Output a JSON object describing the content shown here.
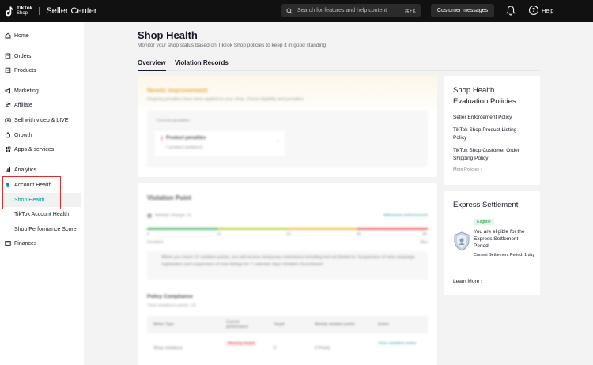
{
  "topbar": {
    "logo_line1": "TikTok",
    "logo_line2": "Shop",
    "app_title": "Seller Center",
    "search_placeholder": "Search for features and help content",
    "search_shortcut": "⌘+K",
    "customer_messages": "Customer messages",
    "help_label": "Help"
  },
  "sidebar": {
    "home": "Home",
    "orders": "Orders",
    "products": "Products",
    "marketing": "Marketing",
    "affiliate": "Affiliate",
    "sell_video": "Sell with video & LIVE",
    "growth": "Growth",
    "apps": "Apps & services",
    "analytics": "Analytics",
    "account_health": "Account Health",
    "shop_health": "Shop Health",
    "tiktok_account_health": "TikTok Account Health",
    "shop_performance_score": "Shop Performance Score",
    "finances": "Finances"
  },
  "page": {
    "title": "Shop Health",
    "subtitle": "Monitor your shop status based on TikTok Shop policies to keep it in good standing",
    "tab_overview": "Overview",
    "tab_violation_records": "Violation Records"
  },
  "needs_improvement": {
    "title": "Needs improvement",
    "subtitle": "Ongoing penalties have been applied to your shop. Check eligibility and penalties.",
    "current_penalties": "Current penalties",
    "product_penalties": "Product penalties",
    "violations": "7 product violations"
  },
  "violation_point": {
    "title": "Violation Point",
    "change": "Weekly change: 11",
    "milestone": "Milestone enforcement",
    "ticks": [
      "0",
      "12",
      "24",
      "36",
      "48"
    ],
    "excellent": "Excellent",
    "max": "Max",
    "note": "When you reach 12 violation points, you will receive temporary restrictions including but not limited to: Suspension of new campaign registration and suspension of new listings for 7 calendar days Violation Scoreboard"
  },
  "policy_compliance": {
    "title": "Policy Compliance",
    "subtitle": "Total violations points: 18",
    "headers": [
      "Metric Type",
      "Current performance",
      "Target",
      "Weekly violation points",
      "Action"
    ],
    "row": [
      "Shop violations",
      "Missing target",
      "0",
      "0 Points",
      "View violation notes"
    ]
  },
  "evaluation_policies": {
    "title": "Shop Health Evaluation Policies",
    "links": [
      "Seller Enforcement Policy",
      "TikTok Shop Product Listing Policy",
      "TikTok Shop Customer Order Shipping Policy"
    ],
    "more": "More Policies ›"
  },
  "express_settlement": {
    "title": "Express Settlement",
    "badge": "Eligible",
    "text": "You are eligible for the Express Settlement Period.",
    "period": "Current Settlement Period: 1 day",
    "learn_more": "Learn More ›"
  },
  "colors": {
    "accent": "#009995",
    "highlight": "#e02c2c",
    "eligible": "#1e9e47"
  }
}
